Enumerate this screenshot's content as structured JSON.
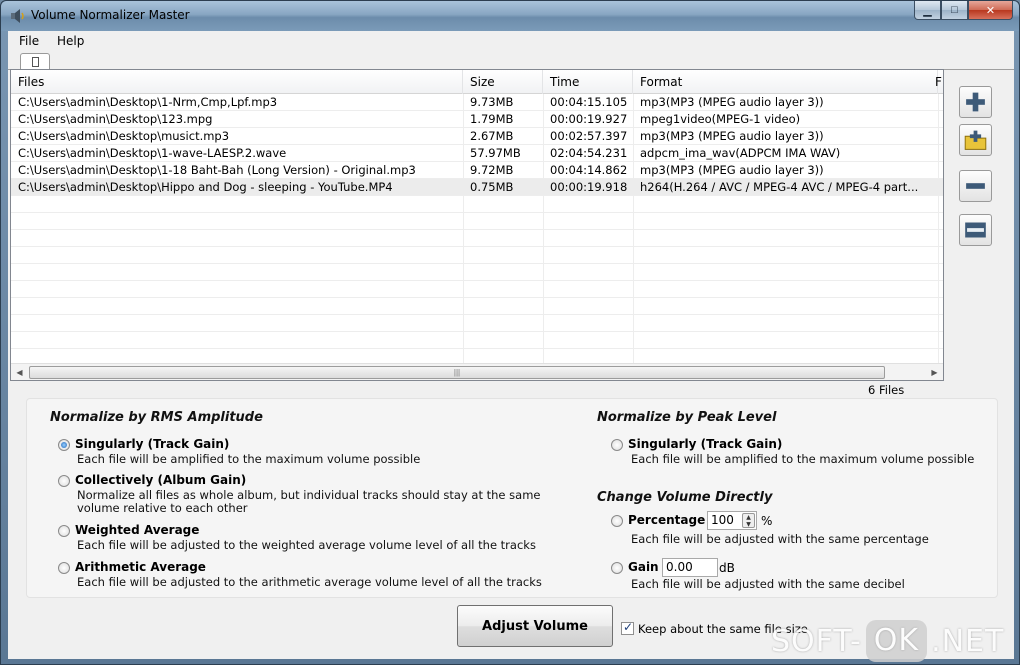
{
  "window": {
    "title": "Volume Normalizer Master",
    "min_symbol": "▁",
    "max_symbol": "□",
    "close_symbol": "✕"
  },
  "menu": {
    "file": "File",
    "help": "Help"
  },
  "list": {
    "columns": {
      "files": "Files",
      "size": "Size",
      "time": "Time",
      "format": "Format",
      "extra": "F"
    },
    "rows": [
      {
        "file": "C:\\Users\\admin\\Desktop\\1-Nrm,Cmp,Lpf.mp3",
        "size": "9.73MB",
        "time": "00:04:15.105",
        "format": "mp3(MP3 (MPEG audio layer 3))"
      },
      {
        "file": "C:\\Users\\admin\\Desktop\\123.mpg",
        "size": "1.79MB",
        "time": "00:00:19.927",
        "format": "mpeg1video(MPEG-1 video)"
      },
      {
        "file": "C:\\Users\\admin\\Desktop\\musict.mp3",
        "size": "2.67MB",
        "time": "00:02:57.397",
        "format": "mp3(MP3 (MPEG audio layer 3))"
      },
      {
        "file": "C:\\Users\\admin\\Desktop\\1-wave-LAESP.2.wave",
        "size": "57.97MB",
        "time": "02:04:54.231",
        "format": "adpcm_ima_wav(ADPCM IMA WAV)"
      },
      {
        "file": "C:\\Users\\admin\\Desktop\\1-18 Baht-Bah (Long Version) - Original.mp3",
        "size": "9.72MB",
        "time": "00:04:14.862",
        "format": "mp3(MP3 (MPEG audio layer 3))"
      },
      {
        "file": "C:\\Users\\admin\\Desktop\\Hippo and Dog - sleeping - YouTube.MP4",
        "size": "0.75MB",
        "time": "00:00:19.918",
        "format": "h264(H.264 / AVC / MPEG-4 AVC / MPEG-4 part..."
      }
    ],
    "scroll_left": "◀",
    "scroll_right": "▶",
    "scroll_grip": "|||",
    "files_count": "6 Files"
  },
  "sidebuttons": {
    "add": "add-files",
    "add_folder": "add-folder",
    "remove": "remove",
    "clear": "clear"
  },
  "rms": {
    "title": "Normalize by RMS Amplitude",
    "options": [
      {
        "label": "Singularly (Track Gain)",
        "desc": "Each file will be amplified to the maximum volume possible",
        "selected": true
      },
      {
        "label": "Collectively (Album Gain)",
        "desc": "Normalize all files as whole album, but individual tracks should stay at the same volume relative to each other",
        "selected": false
      },
      {
        "label": "Weighted Average",
        "desc": "Each file will be adjusted to the weighted average volume level of all the tracks",
        "selected": false
      },
      {
        "label": "Arithmetic Average",
        "desc": "Each file will be adjusted to the arithmetic average volume level of all the tracks",
        "selected": false
      }
    ]
  },
  "peak": {
    "title": "Normalize by Peak Level",
    "label": "Singularly (Track Gain)",
    "desc": "Each file will be amplified to the maximum volume possible"
  },
  "direct": {
    "title": "Change Volume Directly",
    "percentage_label": "Percentage",
    "percentage_value": "100",
    "percentage_unit": "%",
    "percentage_desc": "Each file will be adjusted with the same percentage",
    "gain_label": "Gain",
    "gain_value": "0.00",
    "gain_unit": "dB",
    "gain_desc": "Each file will be adjusted with the same decibel"
  },
  "actions": {
    "adjust": "Adjust Volume",
    "keep_label": "Keep about the same file size",
    "keep_checked": true,
    "check_mark": "✓"
  },
  "watermark": {
    "left": "SOFT-",
    "ok": "OK",
    "right": ".NET"
  }
}
